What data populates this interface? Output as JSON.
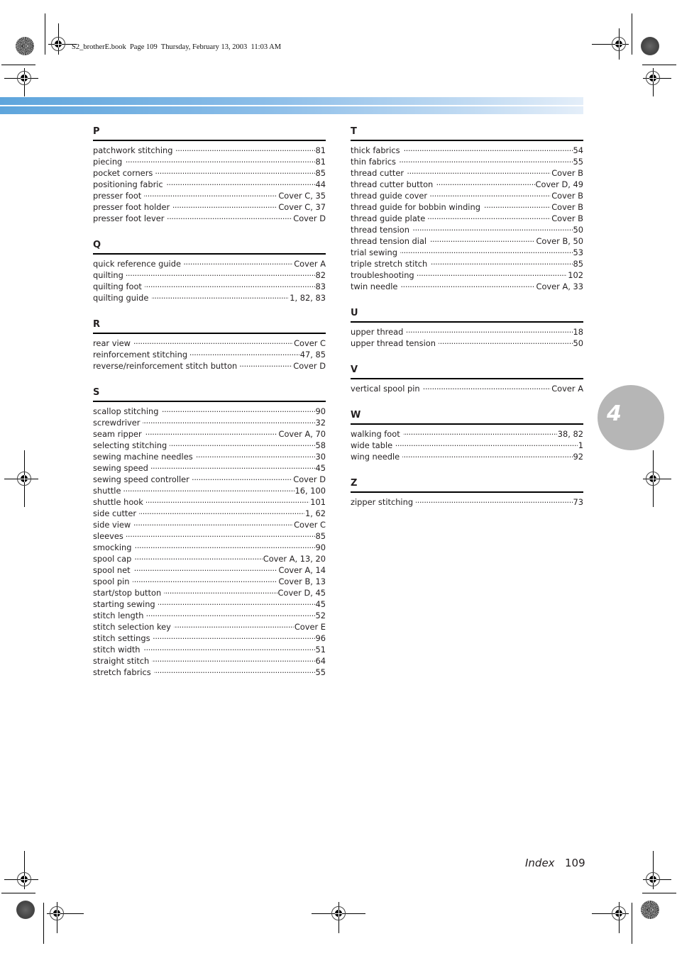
{
  "slug": "S2_brotherE.book  Page 109  Thursday, February 13, 2003  11:03 AM",
  "chapter_tab": "4",
  "footer": {
    "label": "Index",
    "page": "109"
  },
  "left_column": [
    {
      "letter": "P",
      "entries": [
        {
          "term": "patchwork stitching",
          "pages": "81"
        },
        {
          "term": "piecing",
          "pages": "81"
        },
        {
          "term": "pocket corners",
          "pages": "85"
        },
        {
          "term": "positioning fabric",
          "pages": "44"
        },
        {
          "term": "presser foot",
          "pages": "Cover C, 35"
        },
        {
          "term": "presser foot holder",
          "pages": "Cover C, 37"
        },
        {
          "term": "presser foot lever",
          "pages": "Cover D"
        }
      ]
    },
    {
      "letter": "Q",
      "entries": [
        {
          "term": "quick reference guide",
          "pages": "Cover A"
        },
        {
          "term": "quilting",
          "pages": "82"
        },
        {
          "term": "quilting foot",
          "pages": "83"
        },
        {
          "term": "quilting guide",
          "pages": "1, 82, 83"
        }
      ]
    },
    {
      "letter": "R",
      "entries": [
        {
          "term": "rear view",
          "pages": "Cover C"
        },
        {
          "term": "reinforcement stitching",
          "pages": "47, 85"
        },
        {
          "term": "reverse/reinforcement stitch button",
          "pages": "Cover D"
        }
      ]
    },
    {
      "letter": "S",
      "entries": [
        {
          "term": "scallop stitching",
          "pages": "90"
        },
        {
          "term": "screwdriver",
          "pages": "32"
        },
        {
          "term": "seam ripper",
          "pages": "Cover A, 70"
        },
        {
          "term": "selecting stitching",
          "pages": "58"
        },
        {
          "term": "sewing machine needles",
          "pages": "30"
        },
        {
          "term": "sewing speed",
          "pages": "45"
        },
        {
          "term": "sewing speed controller",
          "pages": "Cover D"
        },
        {
          "term": "shuttle",
          "pages": "16, 100"
        },
        {
          "term": "shuttle hook",
          "pages": "101"
        },
        {
          "term": "side cutter",
          "pages": "1, 62"
        },
        {
          "term": "side view",
          "pages": "Cover C"
        },
        {
          "term": "sleeves",
          "pages": "85"
        },
        {
          "term": "smocking",
          "pages": "90"
        },
        {
          "term": "spool cap",
          "pages": "Cover A, 13, 20"
        },
        {
          "term": "spool net",
          "pages": "Cover A, 14"
        },
        {
          "term": "spool pin",
          "pages": "Cover B, 13"
        },
        {
          "term": "start/stop button",
          "pages": "Cover D, 45"
        },
        {
          "term": "starting sewing",
          "pages": "45"
        },
        {
          "term": "stitch length",
          "pages": "52"
        },
        {
          "term": "stitch selection key",
          "pages": "Cover E"
        },
        {
          "term": "stitch settings",
          "pages": "96"
        },
        {
          "term": "stitch width",
          "pages": "51"
        },
        {
          "term": "straight stitch",
          "pages": "64"
        },
        {
          "term": "stretch fabrics",
          "pages": "55"
        }
      ]
    }
  ],
  "right_column": [
    {
      "letter": "T",
      "entries": [
        {
          "term": "thick fabrics",
          "pages": "54"
        },
        {
          "term": "thin fabrics",
          "pages": "55"
        },
        {
          "term": "thread cutter",
          "pages": "Cover B"
        },
        {
          "term": "thread cutter button",
          "pages": "Cover D, 49"
        },
        {
          "term": "thread guide cover",
          "pages": "Cover B"
        },
        {
          "term": "thread guide for bobbin winding",
          "pages": "Cover B"
        },
        {
          "term": "thread guide plate",
          "pages": "Cover B"
        },
        {
          "term": "thread tension",
          "pages": "50"
        },
        {
          "term": "thread tension dial",
          "pages": "Cover B, 50"
        },
        {
          "term": "trial sewing",
          "pages": "53"
        },
        {
          "term": "triple stretch stitch",
          "pages": "85"
        },
        {
          "term": "troubleshooting",
          "pages": "102"
        },
        {
          "term": "twin needle",
          "pages": "Cover A, 33"
        }
      ]
    },
    {
      "letter": "U",
      "entries": [
        {
          "term": "upper thread",
          "pages": "18"
        },
        {
          "term": "upper thread tension",
          "pages": "50"
        }
      ]
    },
    {
      "letter": "V",
      "entries": [
        {
          "term": "vertical spool pin",
          "pages": "Cover A"
        }
      ]
    },
    {
      "letter": "W",
      "entries": [
        {
          "term": "walking foot",
          "pages": "38, 82"
        },
        {
          "term": "wide table",
          "pages": "1"
        },
        {
          "term": "wing needle",
          "pages": "92"
        }
      ]
    },
    {
      "letter": "Z",
      "entries": [
        {
          "term": "zipper stitching",
          "pages": "73"
        }
      ]
    }
  ]
}
